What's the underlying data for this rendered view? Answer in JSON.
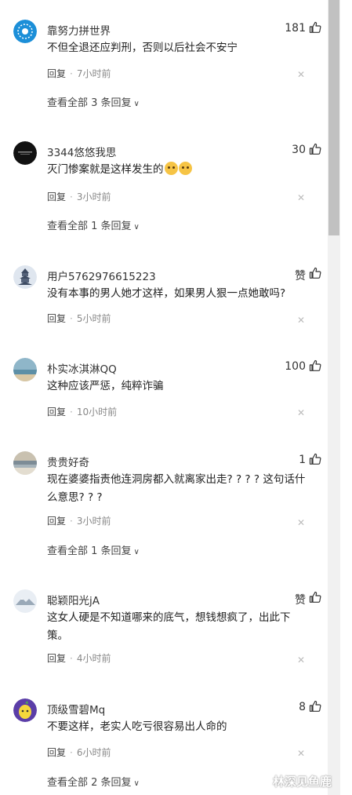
{
  "comments": [
    {
      "username": "靠努力拼世界",
      "likes": "181",
      "content": "不但全退还应判刑，否则以后社会不安宁",
      "reply": "回复",
      "time": "7小时前",
      "view_all": "查看全部 3 条回复",
      "avatar_icon": "blue-ornament-avatar-icon"
    },
    {
      "username": "3344悠悠我思",
      "likes": "30",
      "content": "灭门惨案就是这样发生的",
      "reply": "回复",
      "time": "3小时前",
      "view_all": "查看全部 1 条回复",
      "avatar_icon": "black-logo-avatar-icon",
      "emojis": [
        "thinking-face-emoji",
        "thinking-face-emoji"
      ]
    },
    {
      "username": "用户5762976615223",
      "likes": "赞",
      "content": "没有本事的男人她才这样，如果男人狠一点她敢吗?",
      "reply": "回复",
      "time": "5小时前",
      "avatar_icon": "pagoda-avatar-icon"
    },
    {
      "username": "朴实冰淇淋QQ",
      "likes": "100",
      "content": "这种应该严惩，纯粹诈骗",
      "reply": "回复",
      "time": "10小时前",
      "avatar_icon": "beach-avatar-icon"
    },
    {
      "username": "贵贵好奇",
      "likes": "1",
      "content": "现在婆婆指责他连洞房都入就离家出走? ? ? ? 这句话什么意思? ? ?",
      "reply": "回复",
      "time": "3小时前",
      "view_all": "查看全部 1 条回复",
      "avatar_icon": "landscape-avatar-icon"
    },
    {
      "username": "聪颖阳光jA",
      "likes": "赞",
      "content": "这女人硬是不知道哪来的底气，想钱想疯了，出此下策。",
      "reply": "回复",
      "time": "4小时前",
      "avatar_icon": "snow-mountain-avatar-icon"
    },
    {
      "username": "顶级雪碧Mq",
      "likes": "8",
      "content": "不要这样，老实人吃亏很容易出人命的",
      "reply": "回复",
      "time": "6小时前",
      "view_all": "查看全部 2 条回复",
      "avatar_icon": "lemon-cartoon-avatar-icon"
    }
  ],
  "watermark": "林深见鱼鹿",
  "colors": {
    "text": "#222222",
    "meta": "#888888",
    "background": "#ffffff",
    "scrollbar_thumb": "#c1c1c1"
  }
}
